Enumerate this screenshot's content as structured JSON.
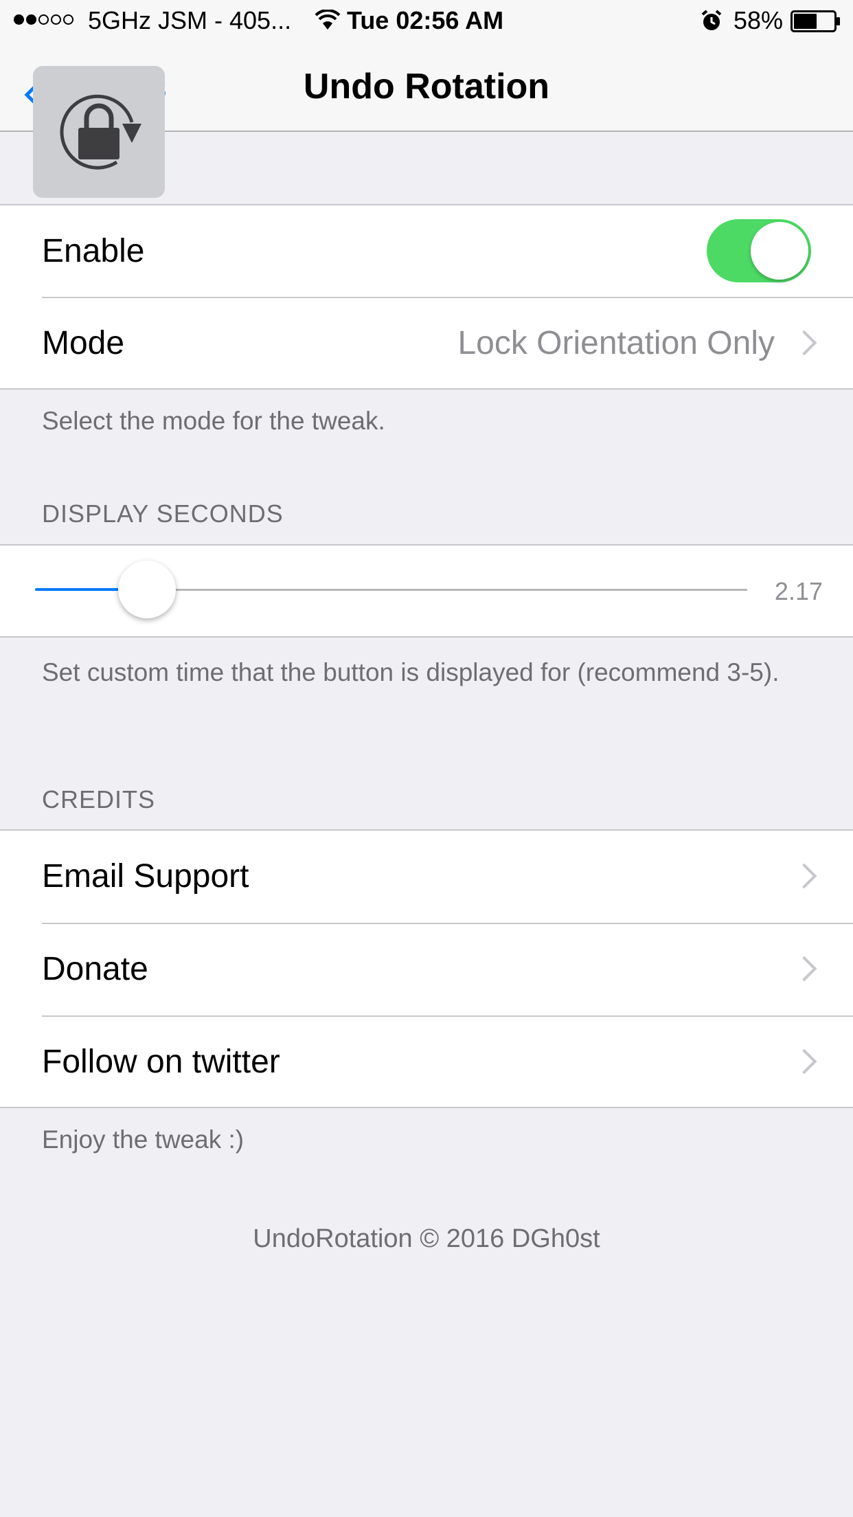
{
  "status_bar": {
    "signal_dots": [
      true,
      true,
      false,
      false,
      false
    ],
    "carrier": "5GHz JSM - 405...",
    "time": "Tue 02:56 AM",
    "battery_percent": "58%",
    "battery_level": 0.58,
    "icons": [
      "wifi-icon",
      "alarm-icon",
      "battery-icon"
    ]
  },
  "nav": {
    "back_label": "Settings",
    "back_visible": "gs",
    "title": "Undo Rotation"
  },
  "overlay": {
    "icon": "rotation-lock-icon"
  },
  "settings": {
    "enable": {
      "label": "Enable",
      "on": true
    },
    "mode": {
      "label": "Mode",
      "value": "Lock Orientation Only"
    },
    "mode_footer": "Select the mode for the tweak."
  },
  "display_seconds": {
    "header": "DISPLAY SECONDS",
    "value": "2.17",
    "footer": "Set custom time that the button is displayed for (recommend 3-5)."
  },
  "credits": {
    "header": "CREDITS",
    "items": [
      {
        "label": "Email Support"
      },
      {
        "label": "Donate"
      },
      {
        "label": "Follow on twitter"
      }
    ],
    "footer": "Enjoy the tweak :)"
  },
  "copyright": "UndoRotation © 2016 DGh0st",
  "colors": {
    "accent": "#007aff",
    "toggle_on": "#4cd964",
    "background": "#efeff4"
  }
}
